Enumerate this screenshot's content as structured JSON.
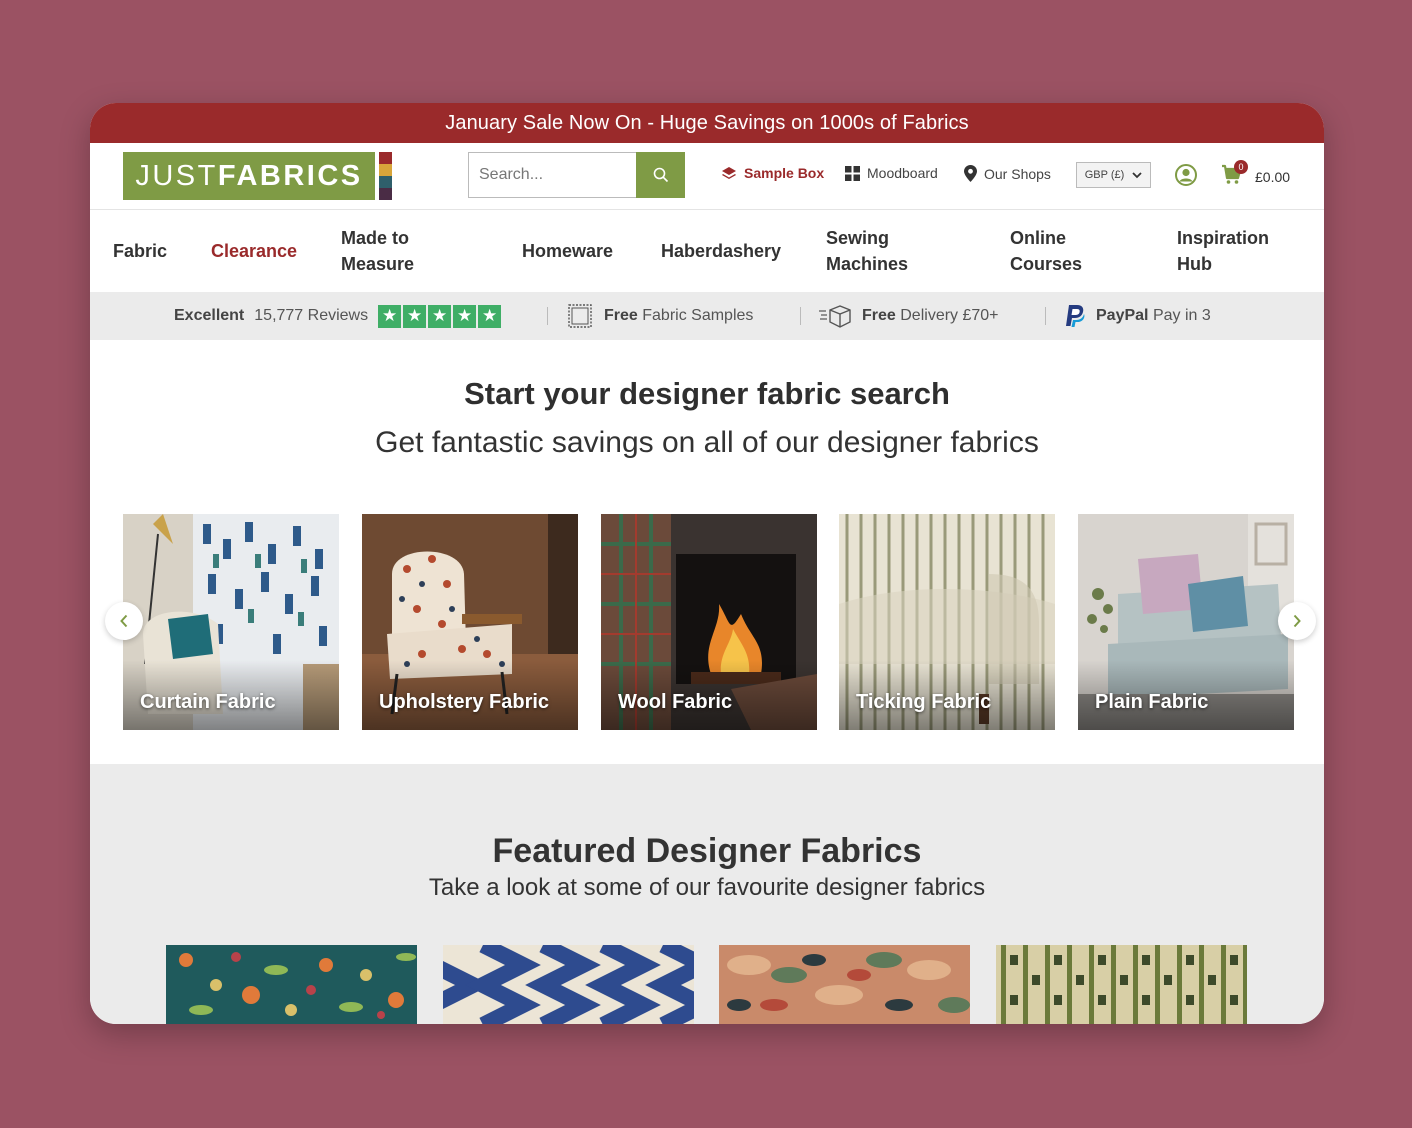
{
  "promo": {
    "text": "January Sale Now On - Huge Savings on 1000s of Fabrics"
  },
  "colors": {
    "brand_red": "#9a2a2b",
    "brand_green": "#7f9b45",
    "background": "#9b5263"
  },
  "logo": {
    "part1": "JUST",
    "part2": "FABRICS"
  },
  "search": {
    "placeholder": "Search...",
    "icon": "search-icon"
  },
  "header": {
    "sample_box": "Sample Box",
    "moodboard": "Moodboard",
    "our_shops": "Our Shops",
    "currency": "GBP (£)",
    "cart_count": "0",
    "cart_total": "£0.00"
  },
  "nav": {
    "fabric": "Fabric",
    "clearance": "Clearance",
    "made_to_measure_1": "Made to",
    "made_to_measure_2": "Measure",
    "homeware": "Homeware",
    "haberdashery": "Haberdashery",
    "sewing_1": "Sewing",
    "sewing_2": "Machines",
    "courses_1": "Online",
    "courses_2": "Courses",
    "inspiration_1": "Inspiration",
    "inspiration_2": "Hub"
  },
  "trust": {
    "rating_label": "Excellent",
    "reviews": "15,777 Reviews",
    "samples_bold": "Free",
    "samples_rest": "Fabric Samples",
    "delivery_bold": "Free",
    "delivery_rest": "Delivery £70+",
    "paypal_bold": "PayPal",
    "paypal_rest": "Pay in 3"
  },
  "hero": {
    "title": "Start your designer fabric search",
    "subtitle": "Get fantastic savings on all of our designer fabrics"
  },
  "categories": [
    {
      "label": "Curtain Fabric"
    },
    {
      "label": "Upholstery Fabric"
    },
    {
      "label": "Wool Fabric"
    },
    {
      "label": "Ticking Fabric"
    },
    {
      "label": "Plain Fabric"
    }
  ],
  "featured": {
    "title": "Featured Designer Fabrics",
    "subtitle": "Take a look at some of our favourite designer fabrics"
  }
}
